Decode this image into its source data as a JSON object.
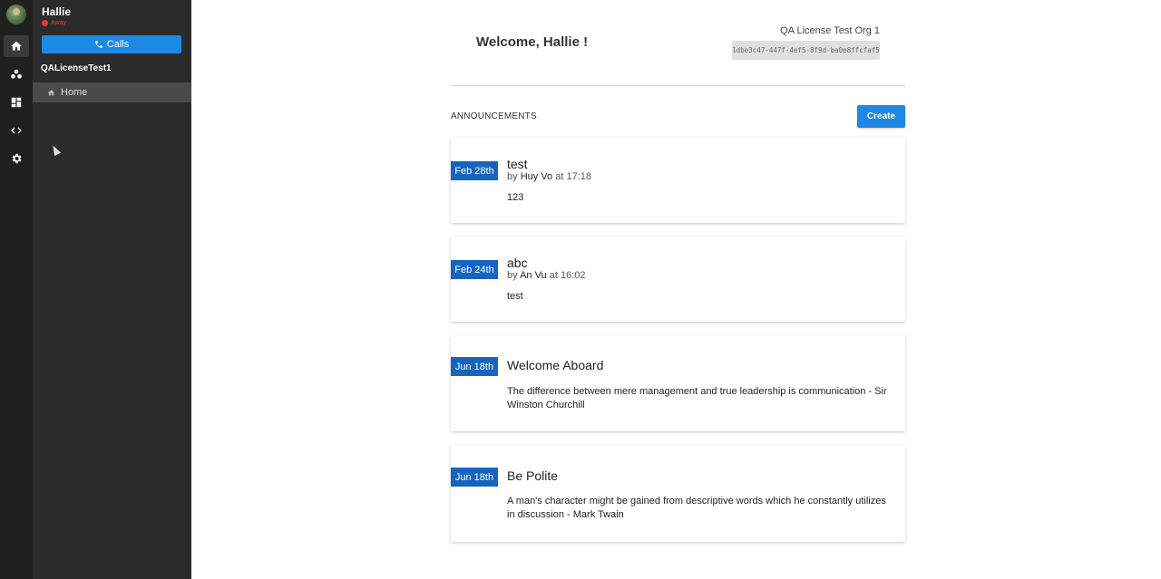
{
  "user": {
    "name": "Hallie",
    "status": "Away"
  },
  "sidebar": {
    "calls_label": "Calls",
    "org_label": "QALicenseTest1",
    "home_label": "Home"
  },
  "rail": {
    "icons": [
      "home-icon",
      "groups-icon",
      "dashboard-icon",
      "code-icon",
      "settings-icon"
    ]
  },
  "header": {
    "welcome": "Welcome, Hallie !",
    "org_name": "QA License Test Org 1",
    "org_id": "1dbe3c47-447f-4ef5-8f9d-ba0e8ffcfaf5"
  },
  "announcements": {
    "heading": "ANNOUNCEMENTS",
    "create_label": "Create",
    "items": [
      {
        "date": "Feb 28th",
        "title": "test",
        "by_prefix": "by",
        "author": "Huy Vo",
        "at_prefix": "at",
        "time": "17:18",
        "body": "123"
      },
      {
        "date": "Feb 24th",
        "title": "abc",
        "by_prefix": "by",
        "author": "An Vu",
        "at_prefix": "at",
        "time": "16:02",
        "body": "test"
      },
      {
        "date": "Jun 18th",
        "title": "Welcome Aboard",
        "body": "The difference between mere management and true leadership is communication - Sir Winston Churchill"
      },
      {
        "date": "Jun 18th",
        "title": "Be Polite",
        "body": "A man's character might be gained from descriptive words which he constantly utilizes in discussion - Mark Twain"
      }
    ]
  },
  "colors": {
    "accent": "#1e88e5",
    "date_badge": "#1565c0",
    "away": "#e53935",
    "rail_bg": "#1f1f1f",
    "sidebar_bg": "#2b2b2b"
  }
}
